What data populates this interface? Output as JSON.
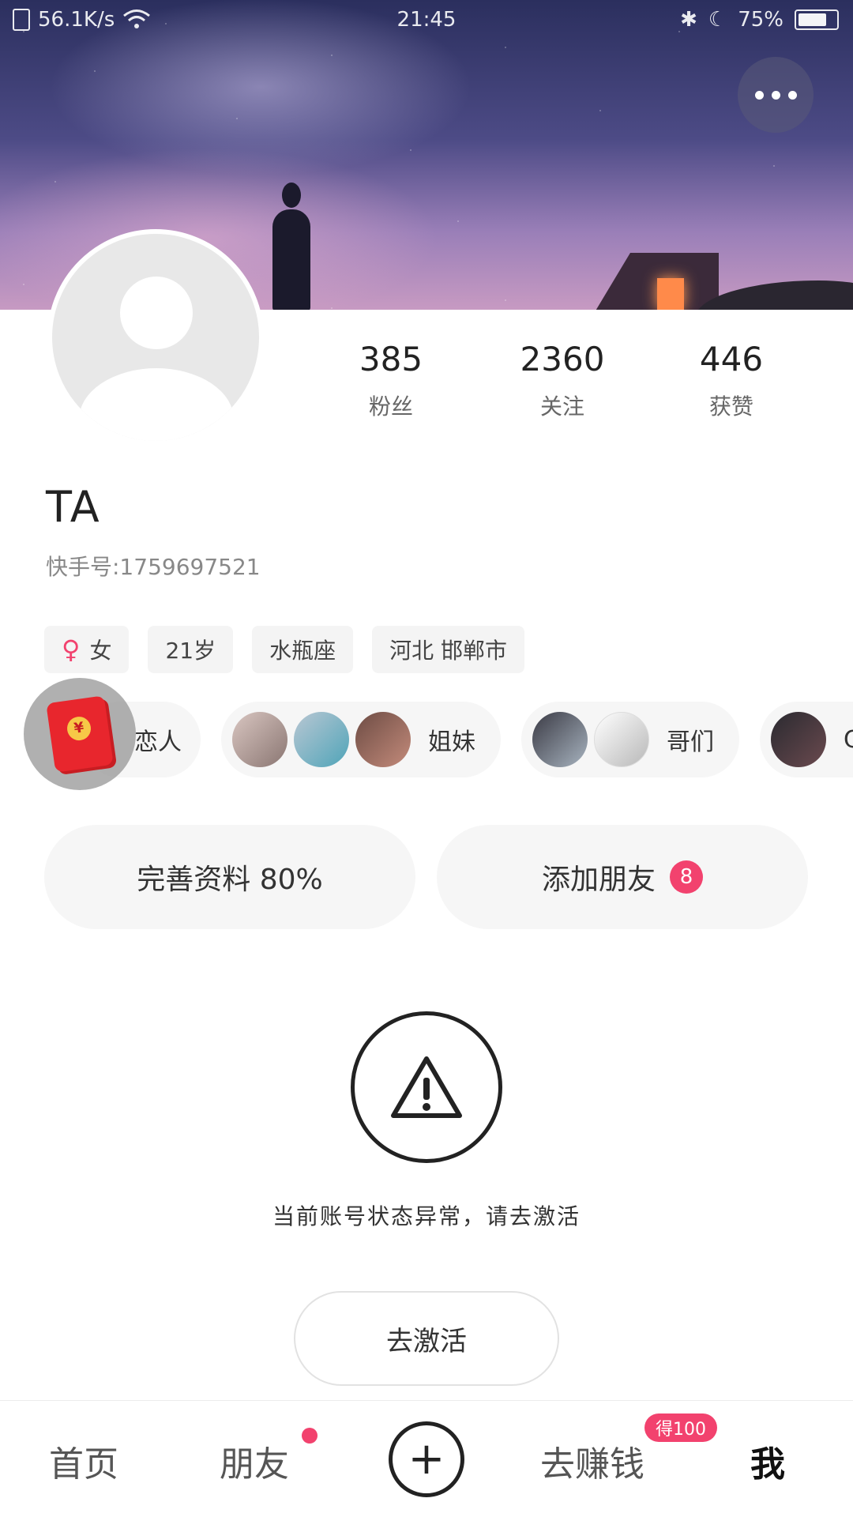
{
  "status_bar": {
    "net_speed": "56.1K/s",
    "time": "21:45",
    "battery_percent": "75%",
    "battery_level": 0.75
  },
  "profile": {
    "name": "TA",
    "id_label": "快手号:1759697521",
    "stats": [
      {
        "value": "385",
        "label": "粉丝"
      },
      {
        "value": "2360",
        "label": "关注"
      },
      {
        "value": "446",
        "label": "获赞"
      }
    ],
    "tags": {
      "gender_icon": "female-icon",
      "gender": "女",
      "age": "21岁",
      "zodiac": "水瓶座",
      "location": "河北 邯郸市"
    }
  },
  "groups": [
    {
      "label": "恋人"
    },
    {
      "label": "姐妹"
    },
    {
      "label": "哥们"
    },
    {
      "label": "C"
    }
  ],
  "actions": {
    "complete_profile": "完善资料 80%",
    "add_friend": "添加朋友",
    "add_friend_badge": "8"
  },
  "warning": {
    "message": "当前账号状态异常，请去激活",
    "button": "去激活"
  },
  "bottom_nav": {
    "home": "首页",
    "friends": "朋友",
    "plus": "+",
    "earn": "去赚钱",
    "earn_badge": "得100",
    "me": "我"
  },
  "colors": {
    "accent": "#f2426e",
    "redpack": "#e8262d"
  }
}
